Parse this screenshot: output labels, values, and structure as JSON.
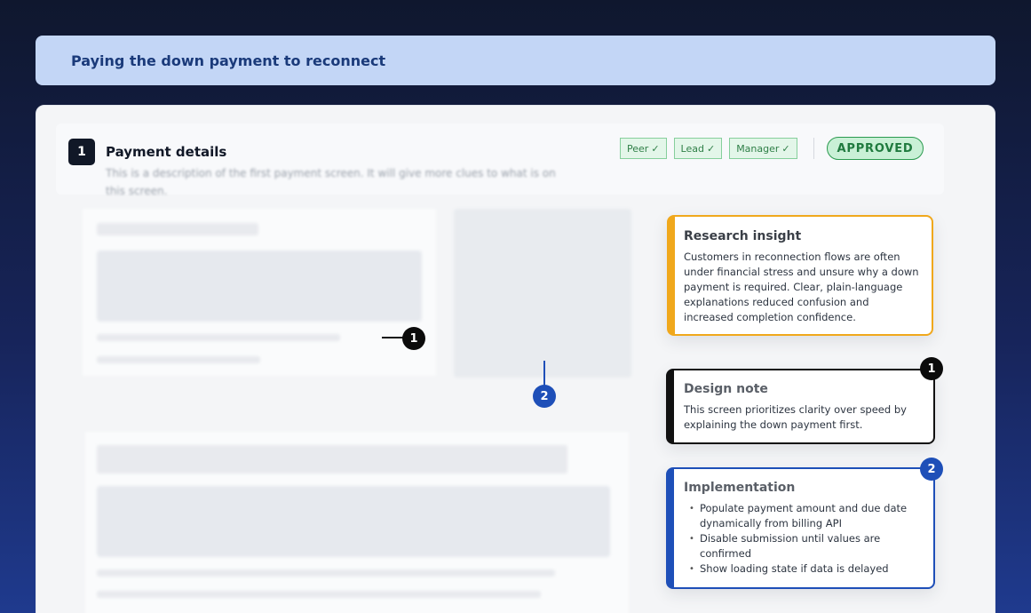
{
  "page_title": "Paying the down payment to reconnect",
  "section": {
    "number": "1",
    "title": "Payment details",
    "description": "This is a description of the first payment screen. It will give more clues to what is on this screen."
  },
  "reviewers": [
    {
      "label": "Peer",
      "check": "✓"
    },
    {
      "label": "Lead",
      "check": "✓"
    },
    {
      "label": "Manager",
      "check": "✓"
    }
  ],
  "status": "APPROVED",
  "markers": {
    "one": "1",
    "two": "2"
  },
  "notes": {
    "research": {
      "title": "Research insight",
      "body": "Customers in reconnection flows are often under financial stress and unsure why a down payment is required. Clear, plain-language explanations reduced confusion and increased completion confidence."
    },
    "design": {
      "marker": "1",
      "title": "Design note",
      "body": "This screen prioritizes clarity over speed by explaining the down payment first."
    },
    "implementation": {
      "marker": "2",
      "title": "Implementation",
      "items": [
        "Populate payment amount and due date dynamically from billing API",
        "Disable submission until values are confirmed",
        "Show loading state if data is delayed"
      ]
    }
  },
  "colors": {
    "research_accent": "#f0a81c",
    "design_accent": "#111111",
    "implementation_accent": "#1e4fb8",
    "approved": "#2b9a4f"
  }
}
